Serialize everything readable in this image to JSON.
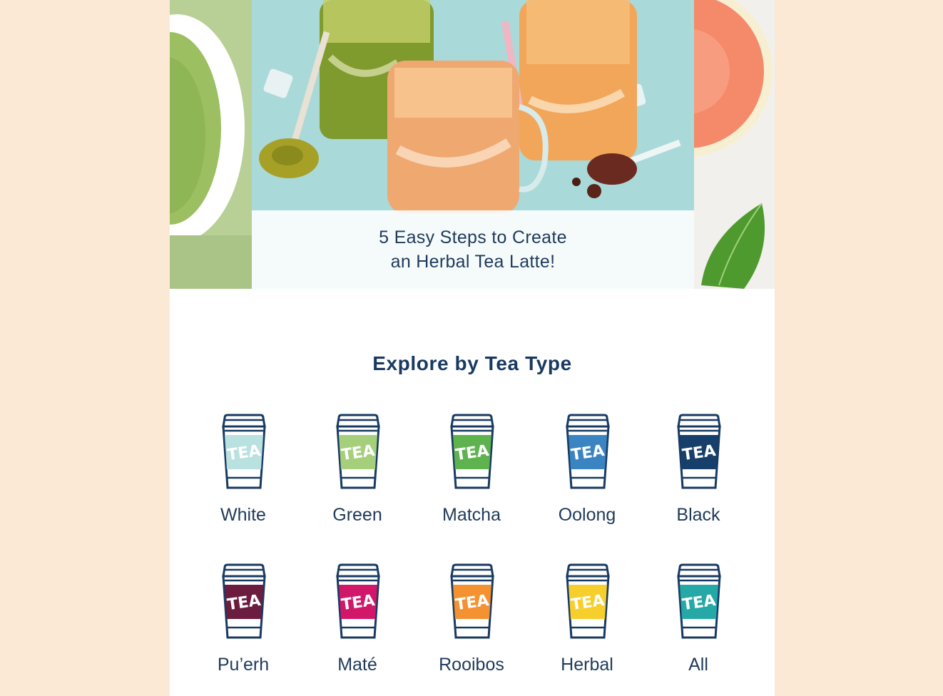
{
  "carousel": {
    "caption_line1": "5 Easy Steps to Create",
    "caption_line2": "an Herbal Tea Latte!"
  },
  "explore": {
    "title": "Explore by Tea Type",
    "cup_text": "TEA",
    "teas": [
      {
        "label": "White",
        "color": "#b9e1df"
      },
      {
        "label": "Green",
        "color": "#a6cf7b"
      },
      {
        "label": "Matcha",
        "color": "#5eb34f"
      },
      {
        "label": "Oolong",
        "color": "#3a84c2"
      },
      {
        "label": "Black",
        "color": "#173f6b"
      },
      {
        "label": "Pu’erh",
        "color": "#6b1c3f"
      },
      {
        "label": "Maté",
        "color": "#d1176a"
      },
      {
        "label": "Rooibos",
        "color": "#f49131"
      },
      {
        "label": "Herbal",
        "color": "#f6cf2c"
      },
      {
        "label": "All",
        "color": "#25a8a6"
      }
    ]
  }
}
